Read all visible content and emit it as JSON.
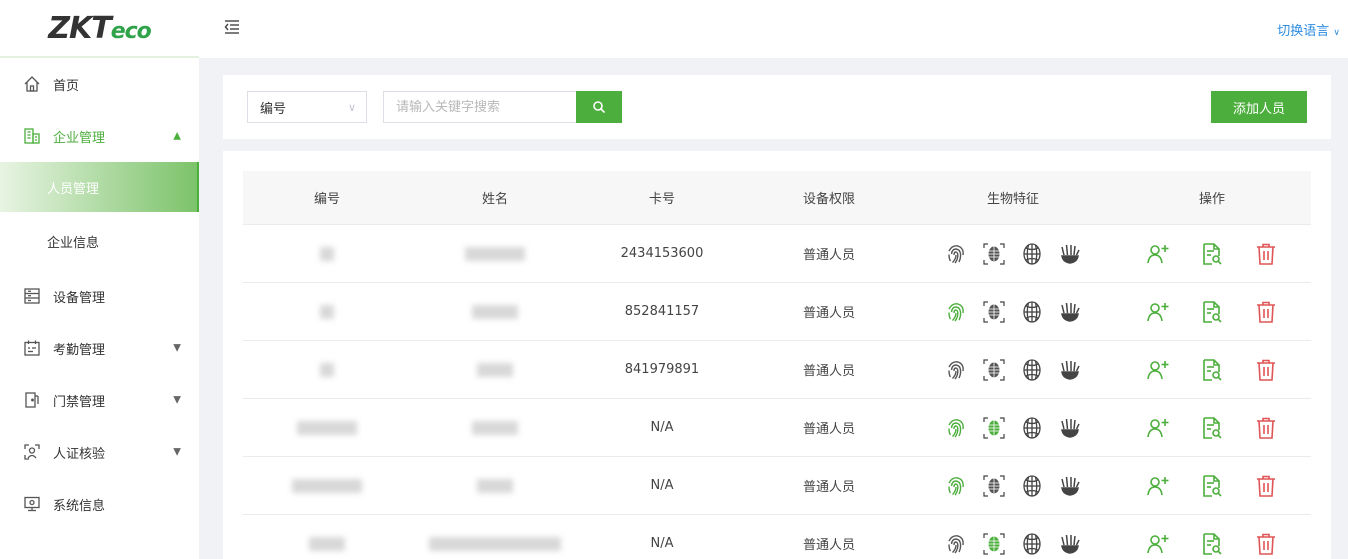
{
  "logo": {
    "main": "ZKT",
    "accent": "eco"
  },
  "header": {
    "language_label": "切换语言"
  },
  "sidebar": {
    "items": [
      {
        "label": "首页",
        "icon": "home-icon"
      },
      {
        "label": "企业管理",
        "icon": "building-icon",
        "expanded": true
      },
      {
        "label": "人员管理",
        "sub": true,
        "active": true
      },
      {
        "label": "企业信息",
        "sub": true
      },
      {
        "label": "设备管理",
        "icon": "device-icon"
      },
      {
        "label": "考勤管理",
        "icon": "calendar-icon"
      },
      {
        "label": "门禁管理",
        "icon": "door-icon"
      },
      {
        "label": "人证核验",
        "icon": "face-verify-icon"
      },
      {
        "label": "系统信息",
        "icon": "monitor-icon"
      }
    ]
  },
  "search": {
    "field_select": "编号",
    "placeholder": "请输入关键字搜索",
    "add_label": "添加人员"
  },
  "table": {
    "headers": [
      "编号",
      "姓名",
      "卡号",
      "设备权限",
      "生物特征",
      "操作"
    ],
    "rows": [
      {
        "card": "2434153600",
        "role": "普通人员",
        "fp": false,
        "face": false
      },
      {
        "card": "852841157",
        "role": "普通人员",
        "fp": true,
        "face": false
      },
      {
        "card": "841979891",
        "role": "普通人员",
        "fp": false,
        "face": false
      },
      {
        "card": "N/A",
        "role": "普通人员",
        "fp": true,
        "face": true
      },
      {
        "card": "N/A",
        "role": "普通人员",
        "fp": true,
        "face": false
      },
      {
        "card": "N/A",
        "role": "普通人员",
        "fp": false,
        "face": true
      }
    ]
  },
  "colors": {
    "accent": "#4cae3c",
    "link": "#2e8ce0",
    "danger": "#e05555"
  }
}
